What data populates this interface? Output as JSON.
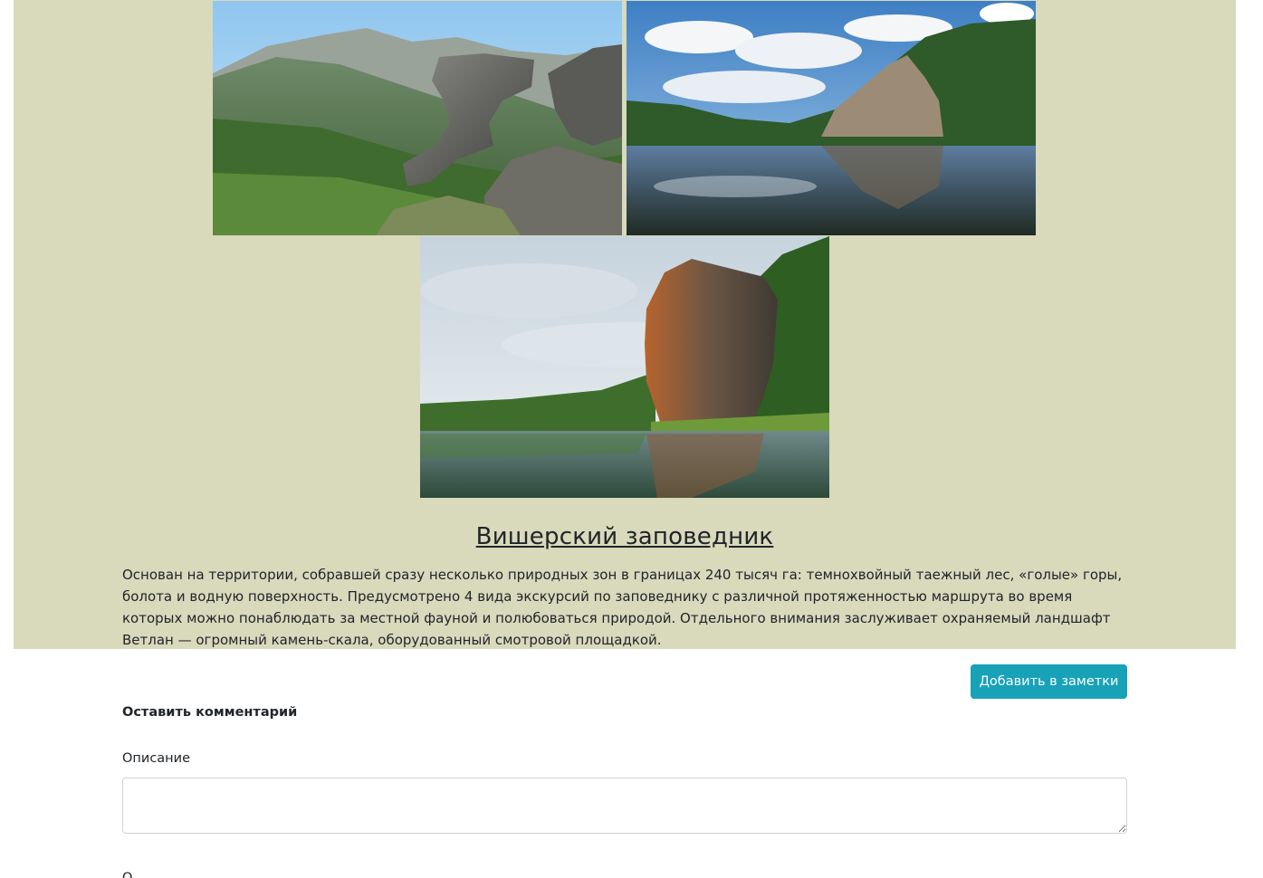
{
  "reserve": {
    "title": "Вишерский заповедник",
    "description": "Основан на территории, собравшей сразу несколько природных зон в границах 240 тысяч га: темнохвойный таежный лес, «голые» горы, болота и водную поверхность. Предусмотрено 4 вида экскурсий по заповеднику с различной протяженностью маршрута во время которых можно понаблюдать за местной фауной и полюбоваться природой. Отдельного внимания заслуживает охраняемый ландшафт Ветлан — огромный камень-скала, оборудованный смотровой площадкой."
  },
  "actions": {
    "add_to_notes": "Добавить в заметки"
  },
  "comment_form": {
    "heading": "Оставить комментарий",
    "description_label": "Описание",
    "description_value": "",
    "next_label": "О"
  },
  "colors": {
    "band_background": "#d9d9bc",
    "accent_button": "#17a2b8"
  }
}
